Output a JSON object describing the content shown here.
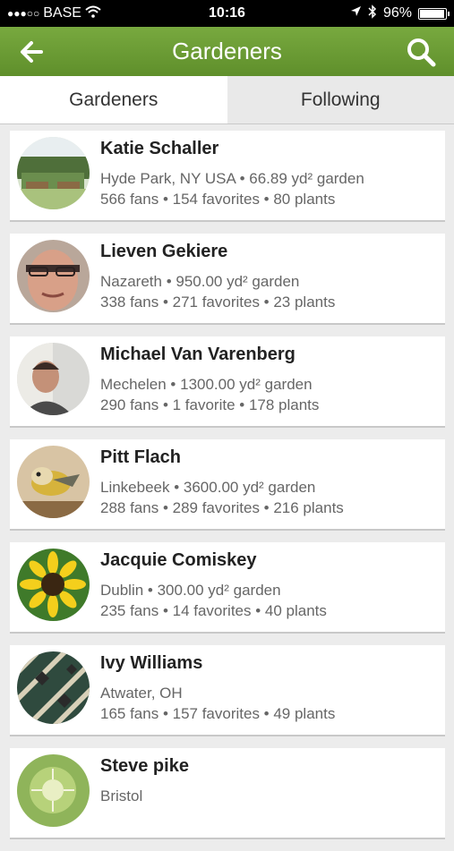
{
  "status": {
    "signal_dots": "●●●○○",
    "carrier": "BASE",
    "time": "10:16",
    "battery_text": "96%",
    "battery_level": 0.96
  },
  "nav": {
    "title": "Gardeners",
    "back_icon": "back-arrow-icon",
    "search_icon": "search-icon"
  },
  "tabs": [
    {
      "label": "Gardeners",
      "active": true
    },
    {
      "label": "Following",
      "active": false
    }
  ],
  "gardeners": [
    {
      "name": "Katie Schaller",
      "location": "Hyde Park, NY USA • 66.89 yd² garden",
      "stats": "566 fans • 154 favorites • 80 plants"
    },
    {
      "name": "Lieven Gekiere",
      "location": "Nazareth • 950.00 yd² garden",
      "stats": "338 fans • 271 favorites • 23 plants"
    },
    {
      "name": "Michael Van Varenberg",
      "location": "Mechelen • 1300.00 yd² garden",
      "stats": "290 fans • 1 favorite • 178 plants"
    },
    {
      "name": "Pitt Flach",
      "location": "Linkebeek • 3600.00 yd² garden",
      "stats": "288 fans • 289 favorites • 216 plants"
    },
    {
      "name": "Jacquie Comiskey",
      "location": "Dublin • 300.00 yd² garden",
      "stats": "235 fans • 14 favorites • 40 plants"
    },
    {
      "name": "Ivy Williams",
      "location": "Atwater, OH",
      "stats": "165 fans • 157 favorites • 49 plants"
    },
    {
      "name": "Steve pike",
      "location": "Bristol",
      "stats": ""
    }
  ]
}
